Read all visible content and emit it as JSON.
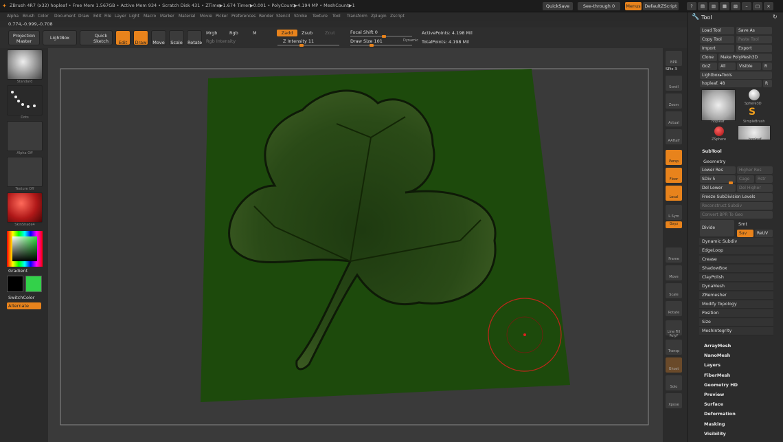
{
  "titlebar": {
    "info": "ZBrush 4R7 (x32)   hopleaf  • Free Mem 1.567GB • Active Mem 934 • Scratch Disk 431 • ZTime▶1.674 Timer▶0.001 • PolyCount▶4.194 MP • MeshCount▶1",
    "quicksave": "QuickSave",
    "seethrough": "See-through  0",
    "menus": "Menus",
    "script": "DefaultZScript"
  },
  "menubar": [
    "Alpha",
    "Brush",
    "Color",
    "Document",
    "Draw",
    "Edit",
    "File",
    "Layer",
    "Light",
    "Macro",
    "Marker",
    "Material",
    "Movie",
    "Picker",
    "Preferences",
    "Render",
    "Stencil",
    "Stroke",
    "Texture",
    "Tool",
    "Transform",
    "Zplugin",
    "Zscript"
  ],
  "coords": "0.774,-0.999,-0.708",
  "toolbar": {
    "projection": "Projection Master",
    "lightbox": "LightBox",
    "quicksketch": "Quick Sketch",
    "edit": "Edit",
    "draw": "Draw",
    "move": "Move",
    "scale": "Scale",
    "rotate": "Rotate",
    "mrgb": "Mrgb",
    "rgb": "Rgb",
    "m": "M",
    "rgb_intensity": "Rgb Intensity",
    "zadd": "Zadd",
    "zsub": "Zsub",
    "zcut": "Zcut",
    "z_intensity": "Z Intensity 11",
    "focal_shift": "Focal Shift 0",
    "draw_size": "Draw Size 101",
    "dynamic": "Dynamic",
    "active_points": "ActivePoints: 4.198 Mil",
    "total_points": "TotalPoints: 4.198 Mil"
  },
  "leftshelf": {
    "standard": "Standard",
    "dots": "Dots",
    "alpha_off": "Alpha Off",
    "texture_off": "Texture Off",
    "material": "SkinShade4",
    "gradient": "Gradient",
    "switchcolor": "SwitchColor",
    "alternate": "Alternate"
  },
  "rightshelf": [
    "BPR",
    "SPix 3",
    "Scroll",
    "Zoom",
    "Actual",
    "AAHalf",
    "Persp",
    "Floor",
    "Local",
    "L.Sym",
    "Gxyz",
    "Frame",
    "Move",
    "Scale",
    "Rotate",
    "Line Fill PolyF",
    "Transp",
    "Ghost",
    "Solo",
    "Xpose"
  ],
  "toolpanel": {
    "title": "Tool",
    "load_tool": "Load Tool",
    "save_as": "Save As",
    "copy_tool": "Copy Tool",
    "paste_tool": "Paste Tool",
    "import": "Import",
    "export": "Export",
    "clone": "Clone",
    "make_polymesh": "Make PolyMesh3D",
    "goz": "GoZ",
    "all": "All",
    "visible": "Visible",
    "r": "R",
    "lightbox_tools": "Lightbox▸Tools",
    "current_tool": "hopleaf. 48",
    "tools": [
      "hopleaf",
      "Sphere3D",
      "SimpleBrush",
      "ZSphere",
      "hopleaf"
    ],
    "subtool": "SubTool",
    "geometry": "Geometry",
    "lower_res": "Lower Res",
    "higher_res": "Higher Res",
    "sdiv": "SDiv 5",
    "cage": "Cage",
    "rstr": "Rstr",
    "del_lower": "Del Lower",
    "del_higher": "Del Higher",
    "freeze": "Freeze SubDivision Levels",
    "reconstruct": "Reconstruct Subdiv",
    "convert_bpr": "Convert BPR To Geo",
    "divide": "Divide",
    "smt": "Smt",
    "suv": "Suv",
    "reuv": "ReUV",
    "geometry_items": [
      "Dynamic Subdiv",
      "EdgeLoop",
      "Crease",
      "ShadowBox",
      "ClayPolish",
      "DynaMesh",
      "ZRemesher",
      "Modify Topology",
      "Position",
      "Size",
      "MeshIntegrity"
    ],
    "sections": [
      "ArrayMesh",
      "NanoMesh",
      "Layers",
      "FiberMesh",
      "Geometry HD",
      "Preview",
      "Surface",
      "Deformation",
      "Masking",
      "Visibility"
    ]
  },
  "colors": {
    "accent": "#e8831c",
    "panel": "#2c2c2c",
    "leaf_bg": "#1f4a0e",
    "brush_ring": "#c0261b"
  }
}
